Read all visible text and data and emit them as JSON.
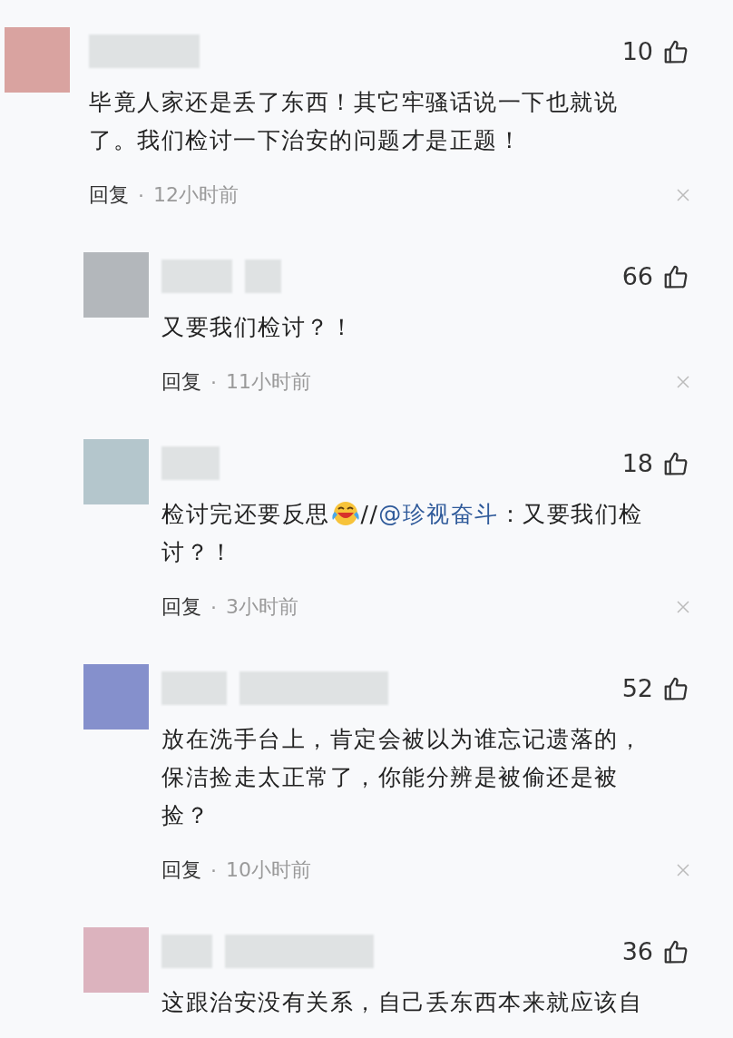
{
  "comments": [
    {
      "color": "#d9a3a0",
      "likes": "10",
      "parts": [
        {
          "kind": "text",
          "text": "毕竟人家还是丢了东西！其它牢骚话说一下也就说了。我们检讨一下治安的问题才是正题！"
        }
      ],
      "reply": "回复",
      "separator": "·",
      "time": "12小时前",
      "replies": [
        {
          "color": "#b3b7bb",
          "likes": "66",
          "parts": [
            {
              "kind": "text",
              "text": "又要我们检讨？！"
            }
          ],
          "reply": "回复",
          "separator": "·",
          "time": "11小时前"
        },
        {
          "color": "#b4c6cc",
          "likes": "18",
          "parts": [
            {
              "kind": "text",
              "text": "检讨完还要反思"
            },
            {
              "kind": "emoji"
            },
            {
              "kind": "text",
              "text": "//"
            },
            {
              "kind": "mention",
              "text": "@珍视奋斗"
            },
            {
              "kind": "text",
              "text": "：又要我们检讨？！"
            }
          ],
          "reply": "回复",
          "separator": "·",
          "time": "3小时前"
        },
        {
          "color": "#8590cc",
          "likes": "52",
          "parts": [
            {
              "kind": "text",
              "text": "放在洗手台上，肯定会被以为谁忘记遗落的，保洁捡走太正常了，你能分辨是被偷还是被捡？"
            }
          ],
          "reply": "回复",
          "separator": "·",
          "time": "10小时前"
        },
        {
          "color": "#dcb3be",
          "likes": "36",
          "parts": [
            {
              "kind": "text",
              "text": "这跟治安没有关系，自己丢东西本来就应该自"
            }
          ]
        }
      ]
    }
  ]
}
